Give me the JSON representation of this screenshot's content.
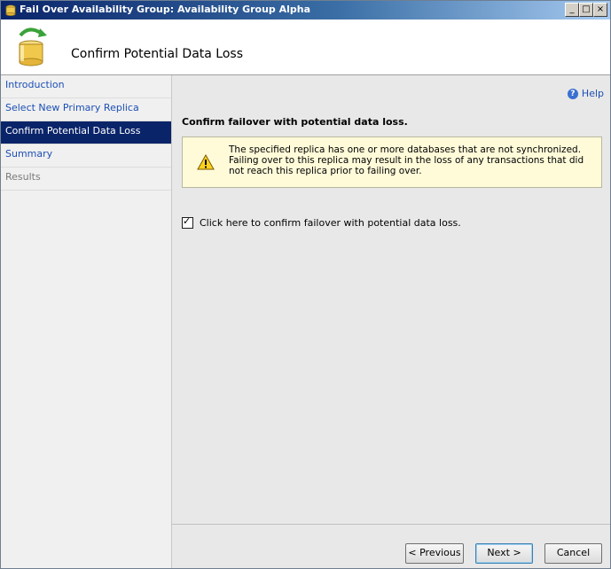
{
  "window": {
    "title": "Fail Over Availability Group: Availability Group Alpha",
    "minimize": "_",
    "maximize": "□",
    "close": "×"
  },
  "banner": {
    "title": "Confirm Potential Data Loss"
  },
  "nav": {
    "items": [
      {
        "label": "Introduction"
      },
      {
        "label": "Select New Primary Replica"
      },
      {
        "label": "Confirm Potential Data Loss"
      },
      {
        "label": "Summary"
      },
      {
        "label": "Results"
      }
    ]
  },
  "main": {
    "help_label": "Help",
    "heading": "Confirm failover with potential data loss.",
    "warning_text": "The specified replica has one or more databases that are not synchronized. Failing over to this replica may result in the loss of any transactions that did not reach this replica prior to failing over.",
    "confirm_label": "Click here to confirm failover with potential data loss.",
    "confirm_checked": true
  },
  "footer": {
    "previous_label": "< Previous",
    "next_label": "Next >",
    "cancel_label": "Cancel"
  },
  "colors": {
    "nav_selected": "#0a246a",
    "link": "#1c4fb5",
    "warning_background": "#fffbd9"
  }
}
